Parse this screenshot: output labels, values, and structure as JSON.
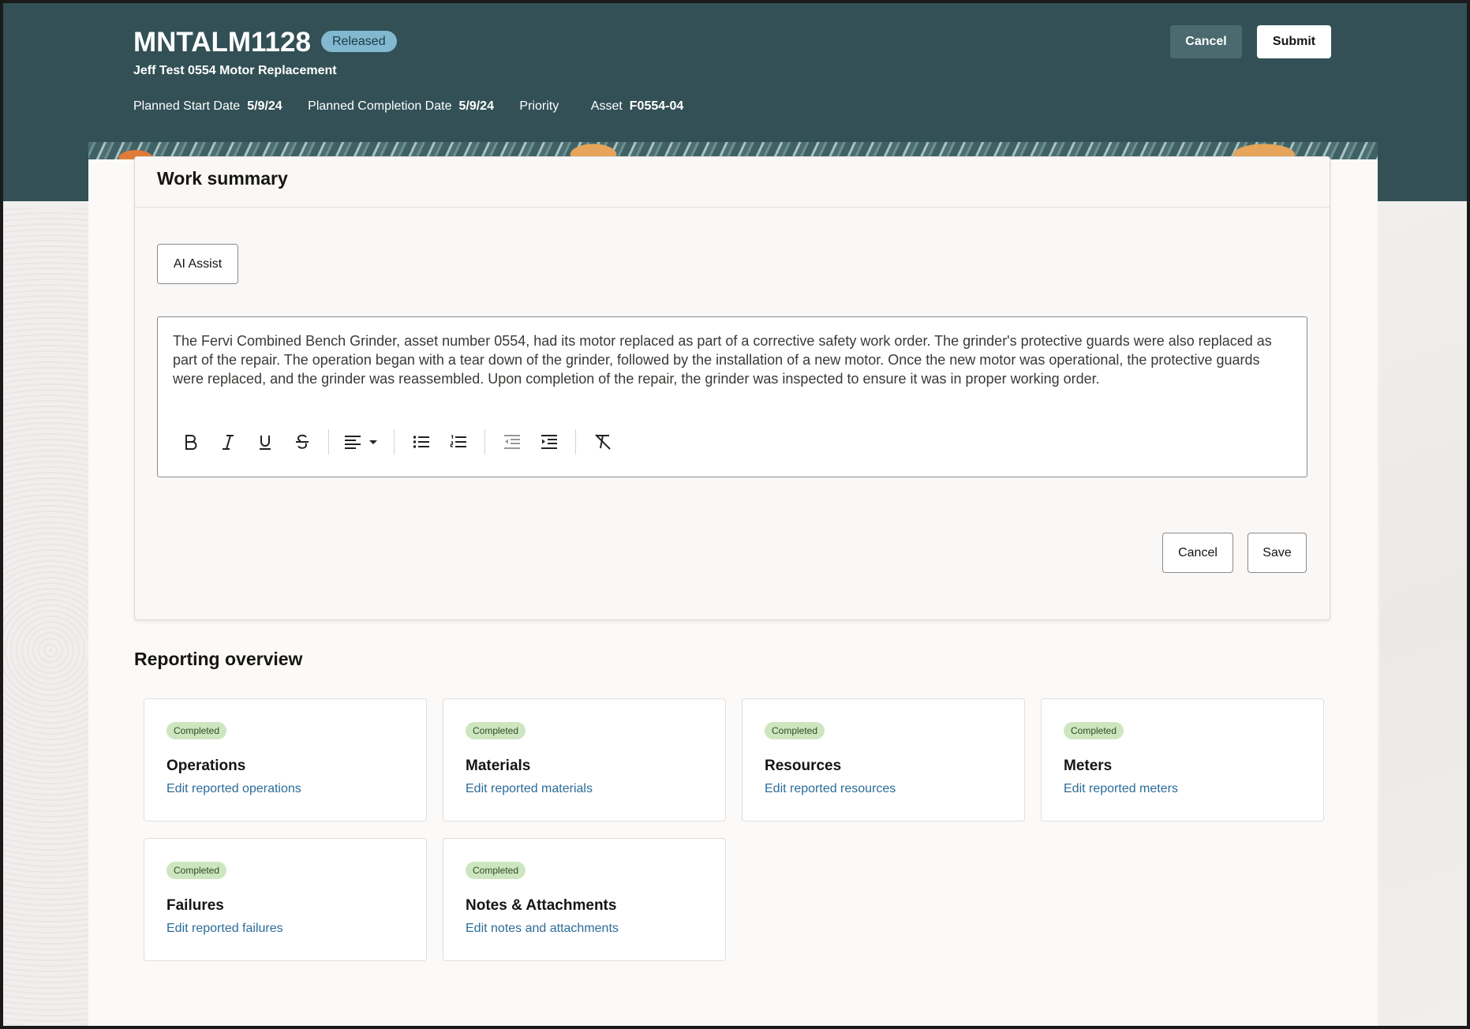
{
  "header": {
    "work_order": "MNTALM1128",
    "status": "Released",
    "subtitle": "Jeff Test 0554 Motor Replacement",
    "meta": [
      {
        "label": "Planned Start Date",
        "value": "5/9/24"
      },
      {
        "label": "Planned Completion Date",
        "value": "5/9/24"
      },
      {
        "label": "Priority",
        "value": ""
      },
      {
        "label": "Asset",
        "value": "F0554-04"
      }
    ],
    "cancel_label": "Cancel",
    "submit_label": "Submit"
  },
  "summary": {
    "title": "Work summary",
    "ai_assist_label": "AI Assist",
    "text": "The Fervi Combined Bench Grinder, asset number 0554, had its motor replaced as part of a corrective safety work order. The grinder's protective guards were also replaced as part of the repair. The operation began with a tear down of the grinder, followed by the installation of a new motor. Once the new motor was operational, the protective guards were replaced, and the grinder was reassembled. Upon completion of the repair, the grinder was inspected to ensure it was in proper working order.",
    "toolbar_icons": [
      "bold-icon",
      "italic-icon",
      "underline-icon",
      "strikethrough-icon",
      "align-left-icon",
      "chevron-down-icon",
      "bullet-list-icon",
      "numbered-list-icon",
      "outdent-icon",
      "indent-icon",
      "clear-formatting-icon"
    ],
    "cancel_label": "Cancel",
    "save_label": "Save"
  },
  "reporting": {
    "title": "Reporting overview",
    "cards": [
      {
        "badge": "Completed",
        "name": "Operations",
        "link": "Edit reported operations"
      },
      {
        "badge": "Completed",
        "name": "Materials",
        "link": "Edit reported materials"
      },
      {
        "badge": "Completed",
        "name": "Resources",
        "link": "Edit reported resources"
      },
      {
        "badge": "Completed",
        "name": "Meters",
        "link": "Edit reported meters"
      },
      {
        "badge": "Completed",
        "name": "Failures",
        "link": "Edit reported failures"
      },
      {
        "badge": "Completed",
        "name": "Notes & Attachments",
        "link": "Edit notes and attachments"
      }
    ]
  },
  "colors": {
    "header_bg": "#325056",
    "status_pill": "#82b8d0",
    "badge_bg": "#cde6c0",
    "link": "#2c6c9a"
  }
}
